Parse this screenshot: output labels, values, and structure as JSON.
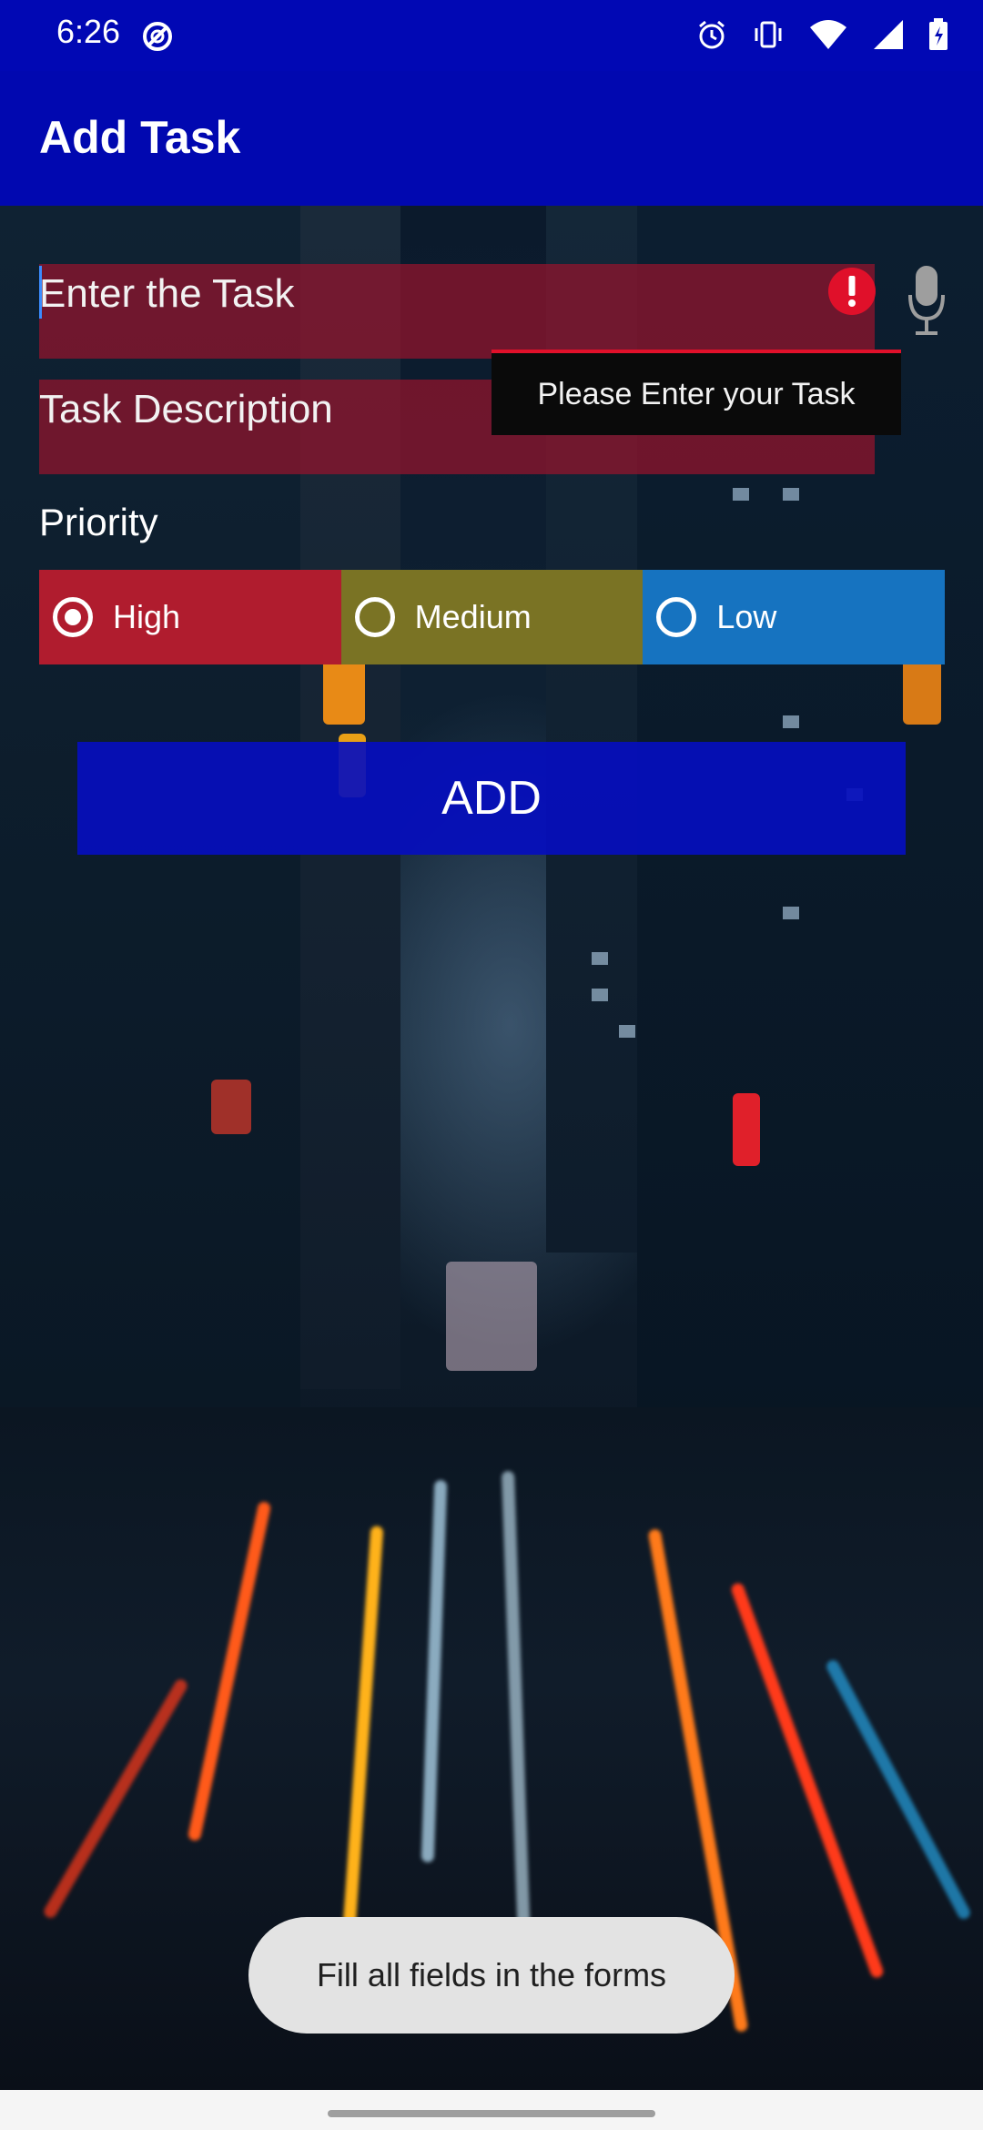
{
  "status_bar": {
    "time": "6:26"
  },
  "app_bar": {
    "title": "Add Task"
  },
  "form": {
    "task_field": {
      "placeholder": "Enter the Task",
      "value": ""
    },
    "description_field": {
      "placeholder": "Task Description",
      "value": ""
    },
    "error_tooltip": "Please Enter your Task",
    "priority_label": "Priority",
    "priority_options": [
      {
        "label": "High",
        "selected": true,
        "color": "#b01c2e"
      },
      {
        "label": "Medium",
        "selected": false,
        "color": "#7a7324"
      },
      {
        "label": "Low",
        "selected": false,
        "color": "#1673c0"
      }
    ],
    "add_button": "ADD"
  },
  "toast": "Fill all fields in the forms",
  "colors": {
    "app_bar": "#0108b0",
    "error": "#e0102a"
  }
}
